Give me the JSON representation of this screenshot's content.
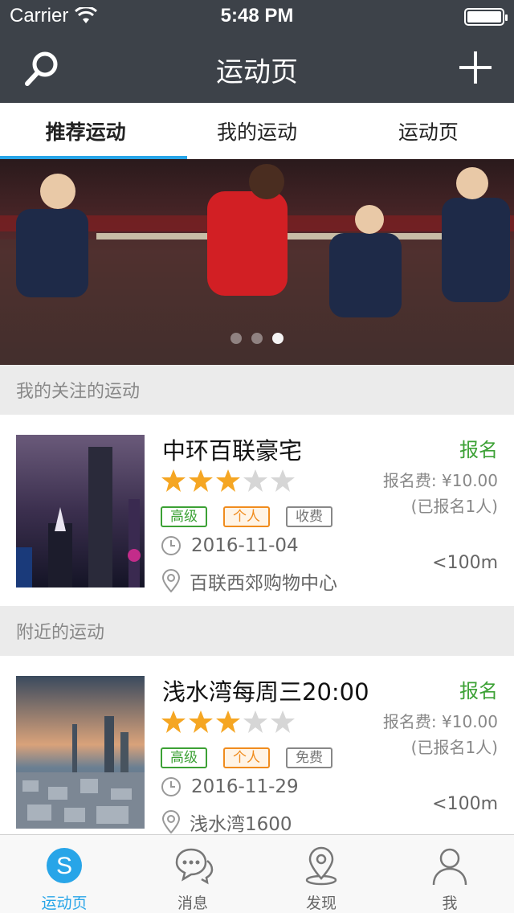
{
  "status": {
    "carrier": "Carrier",
    "time": "5:48 PM"
  },
  "nav": {
    "title": "运动页"
  },
  "tabs": [
    {
      "label": "推荐运动",
      "active": true
    },
    {
      "label": "我的运动",
      "active": false
    },
    {
      "label": "运动页",
      "active": false
    }
  ],
  "sections": {
    "followed": "我的关注的运动",
    "nearby": "附近的运动"
  },
  "cards": [
    {
      "title": "中环百联豪宅",
      "signup": "报名",
      "rating": 3,
      "max_rating": 5,
      "tags": [
        {
          "label": "高级",
          "style": "green"
        },
        {
          "label": "个人",
          "style": "orange"
        },
        {
          "label": "收费",
          "style": "gray"
        }
      ],
      "date": "2016-11-04",
      "location": "百联西郊购物中心",
      "fee": "报名费: ¥10.00",
      "signed": "(已报名1人)",
      "distance": "<100m"
    },
    {
      "title": "浅水湾每周三20:00",
      "signup": "报名",
      "rating": 3,
      "max_rating": 5,
      "tags": [
        {
          "label": "高级",
          "style": "green"
        },
        {
          "label": "个人",
          "style": "orange"
        },
        {
          "label": "免费",
          "style": "gray"
        }
      ],
      "date": "2016-11-29",
      "location": "浅水湾1600",
      "fee": "报名费: ¥10.00",
      "signed": "(已报名1人)",
      "distance": "<100m"
    }
  ],
  "banner": {
    "slides": 3,
    "active_slide": 3
  },
  "tabbar": [
    {
      "label": "运动页",
      "icon": "sport-s-icon",
      "active": true
    },
    {
      "label": "消息",
      "icon": "chat-icon",
      "active": false
    },
    {
      "label": "发现",
      "icon": "location-pin-icon",
      "active": false
    },
    {
      "label": "我",
      "icon": "person-icon",
      "active": false
    }
  ],
  "colors": {
    "nav_bg": "#3d4249",
    "accent": "#28a5e8",
    "green": "#3ca135",
    "orange": "#f08c1e",
    "star": "#f5a623"
  }
}
